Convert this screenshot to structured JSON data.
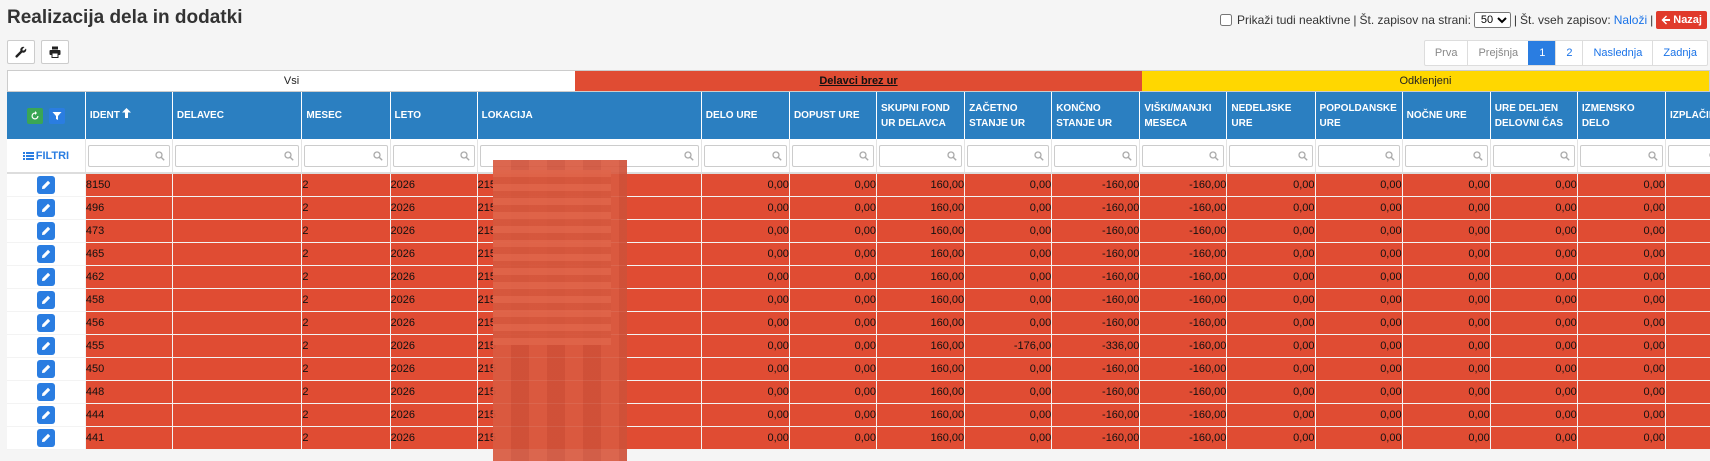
{
  "title": "Realizacija dela in dodatki",
  "topbar": {
    "show_inactive_label": "Prikaži tudi neaktivne",
    "sep1": "|",
    "per_page_label": "Št. zapisov na strani:",
    "per_page_value": "50",
    "sep2": "|",
    "total_label": "Št. vseh zapisov:",
    "load_link": "Naloži",
    "sep3": "|",
    "back_label": "Nazaj"
  },
  "pager": {
    "first": "Prva",
    "prev": "Prejšnja",
    "page1": "1",
    "page2": "2",
    "next": "Naslednja",
    "last": "Zadnja"
  },
  "category_tabs": {
    "all": "Vsi",
    "no_hours": "Delavci brez ur",
    "disconnected": "Odklenjeni"
  },
  "filters_label": "FILTRI",
  "columns": [
    "IDENT",
    "DELAVEC",
    "MESEC",
    "LETO",
    "LOKACIJA",
    "DELO URE",
    "DOPUST URE",
    "SKUPNI FOND UR DELAVCA",
    "ZAČETNO STANJE UR",
    "KONČNO STANJE UR",
    "VIŠKI/MANJKI MESECA",
    "NEDELJSKE URE",
    "POPOLDANSKE URE",
    "NOČNE URE",
    "URE DELJEN DELOVNI ČAS",
    "IZMENSKO DELO",
    "IZPLAČIL"
  ],
  "rows": [
    {
      "ident": "8150",
      "delavec": "",
      "mesec": "2",
      "leto": "2026",
      "lokacija": "215",
      "delo": "0,00",
      "dopust": "0,00",
      "fond": "160,00",
      "zacetno": "0,00",
      "koncno": "-160,00",
      "viski": "-160,00",
      "nedeljske": "0,00",
      "popoldanske": "0,00",
      "nocne": "0,00",
      "deljen": "0,00",
      "izmensko": "0,00"
    },
    {
      "ident": "496",
      "delavec": "",
      "mesec": "2",
      "leto": "2026",
      "lokacija": "215",
      "delo": "0,00",
      "dopust": "0,00",
      "fond": "160,00",
      "zacetno": "0,00",
      "koncno": "-160,00",
      "viski": "-160,00",
      "nedeljske": "0,00",
      "popoldanske": "0,00",
      "nocne": "0,00",
      "deljen": "0,00",
      "izmensko": "0,00"
    },
    {
      "ident": "473",
      "delavec": "",
      "mesec": "2",
      "leto": "2026",
      "lokacija": "215",
      "delo": "0,00",
      "dopust": "0,00",
      "fond": "160,00",
      "zacetno": "0,00",
      "koncno": "-160,00",
      "viski": "-160,00",
      "nedeljske": "0,00",
      "popoldanske": "0,00",
      "nocne": "0,00",
      "deljen": "0,00",
      "izmensko": "0,00"
    },
    {
      "ident": "465",
      "delavec": "",
      "mesec": "2",
      "leto": "2026",
      "lokacija": "215",
      "delo": "0,00",
      "dopust": "0,00",
      "fond": "160,00",
      "zacetno": "0,00",
      "koncno": "-160,00",
      "viski": "-160,00",
      "nedeljske": "0,00",
      "popoldanske": "0,00",
      "nocne": "0,00",
      "deljen": "0,00",
      "izmensko": "0,00"
    },
    {
      "ident": "462",
      "delavec": "",
      "mesec": "2",
      "leto": "2026",
      "lokacija": "215",
      "delo": "0,00",
      "dopust": "0,00",
      "fond": "160,00",
      "zacetno": "0,00",
      "koncno": "-160,00",
      "viski": "-160,00",
      "nedeljske": "0,00",
      "popoldanske": "0,00",
      "nocne": "0,00",
      "deljen": "0,00",
      "izmensko": "0,00"
    },
    {
      "ident": "458",
      "delavec": "",
      "mesec": "2",
      "leto": "2026",
      "lokacija": "215",
      "delo": "0,00",
      "dopust": "0,00",
      "fond": "160,00",
      "zacetno": "0,00",
      "koncno": "-160,00",
      "viski": "-160,00",
      "nedeljske": "0,00",
      "popoldanske": "0,00",
      "nocne": "0,00",
      "deljen": "0,00",
      "izmensko": "0,00"
    },
    {
      "ident": "456",
      "delavec": "",
      "mesec": "2",
      "leto": "2026",
      "lokacija": "215",
      "delo": "0,00",
      "dopust": "0,00",
      "fond": "160,00",
      "zacetno": "0,00",
      "koncno": "-160,00",
      "viski": "-160,00",
      "nedeljske": "0,00",
      "popoldanske": "0,00",
      "nocne": "0,00",
      "deljen": "0,00",
      "izmensko": "0,00"
    },
    {
      "ident": "455",
      "delavec": "",
      "mesec": "2",
      "leto": "2026",
      "lokacija": "215",
      "delo": "0,00",
      "dopust": "0,00",
      "fond": "160,00",
      "zacetno": "-176,00",
      "koncno": "-336,00",
      "viski": "-160,00",
      "nedeljske": "0,00",
      "popoldanske": "0,00",
      "nocne": "0,00",
      "deljen": "0,00",
      "izmensko": "0,00"
    },
    {
      "ident": "450",
      "delavec": "",
      "mesec": "2",
      "leto": "2026",
      "lokacija": "215",
      "delo": "0,00",
      "dopust": "0,00",
      "fond": "160,00",
      "zacetno": "0,00",
      "koncno": "-160,00",
      "viski": "-160,00",
      "nedeljske": "0,00",
      "popoldanske": "0,00",
      "nocne": "0,00",
      "deljen": "0,00",
      "izmensko": "0,00"
    },
    {
      "ident": "448",
      "delavec": "",
      "mesec": "2",
      "leto": "2026",
      "lokacija": "215",
      "delo": "0,00",
      "dopust": "0,00",
      "fond": "160,00",
      "zacetno": "0,00",
      "koncno": "-160,00",
      "viski": "-160,00",
      "nedeljske": "0,00",
      "popoldanske": "0,00",
      "nocne": "0,00",
      "deljen": "0,00",
      "izmensko": "0,00"
    },
    {
      "ident": "444",
      "delavec": "",
      "mesec": "2",
      "leto": "2026",
      "lokacija": "215",
      "delo": "0,00",
      "dopust": "0,00",
      "fond": "160,00",
      "zacetno": "0,00",
      "koncno": "-160,00",
      "viski": "-160,00",
      "nedeljske": "0,00",
      "popoldanske": "0,00",
      "nocne": "0,00",
      "deljen": "0,00",
      "izmensko": "0,00"
    },
    {
      "ident": "441",
      "delavec": "",
      "mesec": "2",
      "leto": "2026",
      "lokacija": "215",
      "delo": "0,00",
      "dopust": "0,00",
      "fond": "160,00",
      "zacetno": "0,00",
      "koncno": "-160,00",
      "viski": "-160,00",
      "nedeljske": "0,00",
      "popoldanske": "0,00",
      "nocne": "0,00",
      "deljen": "0,00",
      "izmensko": "0,00"
    }
  ],
  "icons": {
    "settings": "wrench-icon",
    "print": "printer-icon",
    "refresh": "refresh-icon",
    "filter": "filter-icon",
    "edit": "pencil-icon",
    "search": "search-icon",
    "sort": "arrow-up-icon",
    "back": "arrow-left-icon",
    "filters": "list-icon"
  },
  "colors": {
    "header_bg": "#2b7fc1",
    "row_highlight": "#e04c33",
    "tab_warning": "#ffd700",
    "accent": "#2a7de1",
    "back_button": "#e03a2b"
  }
}
